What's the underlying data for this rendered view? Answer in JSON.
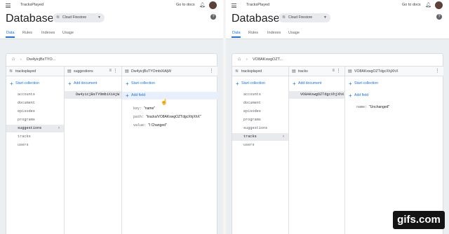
{
  "left": {
    "topbar": {
      "project": "TracksPlayed",
      "go_to_docs": "Go to docs"
    },
    "header": {
      "title": "Database",
      "db_chip": "Cloud Firestore",
      "tabs": [
        "Data",
        "Rules",
        "Indexes",
        "Usage"
      ]
    },
    "breadcrumb": "Dw4yicjBsTYO...",
    "col1": {
      "title": "tracksplayed",
      "action": "Start collection",
      "items": [
        "accounts",
        "document",
        "episodes",
        "programs",
        "suggestions",
        "tracks",
        "users"
      ]
    },
    "col2": {
      "title": "suggestions",
      "action": "Add document",
      "selected": "Dw4yicjBsTYOmbiXiAjW"
    },
    "col3": {
      "title": "Dw4yicjBsTYOmbiXiAjW",
      "action1": "Start collection",
      "action2": "Add field",
      "fields": [
        {
          "key": "key:",
          "val": "\"name\""
        },
        {
          "key": "path:",
          "val": "\"tracks/VO8AKxwgOZTdgcXhjXhX\""
        },
        {
          "key": "value:",
          "val": "\"I Changed\""
        }
      ]
    }
  },
  "right": {
    "topbar": {
      "project": "TracksPlayed",
      "go_to_docs": "Go to docs"
    },
    "header": {
      "title": "Database",
      "db_chip": "Cloud Firestore",
      "tabs": [
        "Data",
        "Rules",
        "Indexes",
        "Usage"
      ]
    },
    "breadcrumb": "VO8AKxwgOZT...",
    "col1": {
      "title": "tracksplayed",
      "action": "Start collection",
      "items": [
        "accounts",
        "document",
        "episodes",
        "programs",
        "suggestions",
        "tracks",
        "users"
      ]
    },
    "col2": {
      "title": "tracks",
      "action": "Add document",
      "selected": "VO8AKxwgOZTdgcXhjXhX"
    },
    "col3": {
      "title": "VO8AKxwgOZTdgcXhjXhX",
      "action1": "Start collection",
      "action2": "Add field",
      "fields": [
        {
          "key": "name:",
          "val": "\"Unchanged\""
        }
      ]
    }
  },
  "watermark": "gifs.com"
}
